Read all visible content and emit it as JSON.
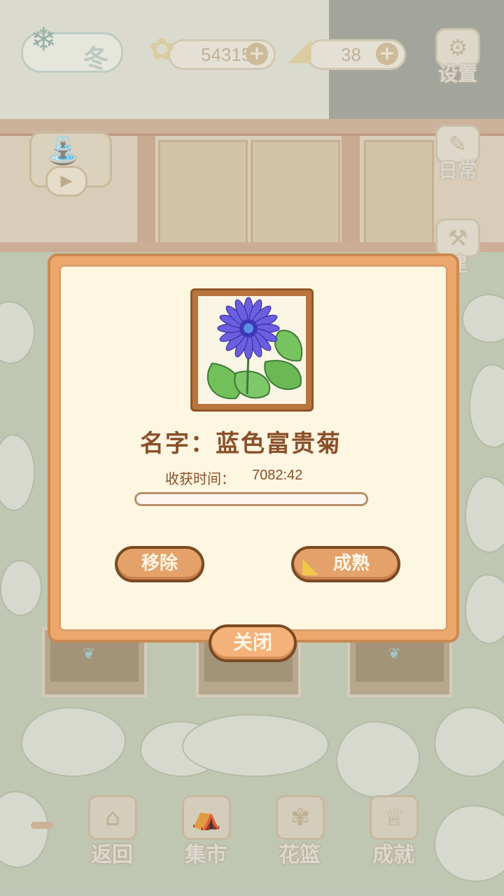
{
  "hud": {
    "season_label": "冬",
    "fish_coins": "54315",
    "cheese": "38",
    "plus_symbol": "+",
    "settings_label": "设置",
    "daily_label": "日常",
    "build_label": "建"
  },
  "dialog": {
    "flower_name": "名字：蓝色富贵菊",
    "harvest_label": "收获时间：",
    "harvest_time": "7082:42",
    "progress_fraction": 0.0,
    "remove_label": "移除",
    "ripen_label": "成熟",
    "close_label": "关闭"
  },
  "bottom_nav": {
    "back_label": "返回",
    "market_label": "集市",
    "basket_label": "花篮",
    "achievements_label": "成就"
  },
  "colors": {
    "dialog_border": "#eea76a",
    "dialog_bg": "#fdf6e1",
    "text_brown": "#8a4f2a",
    "button_fill": "#e4a26a",
    "flower_petal": "#6c5ee0",
    "leaf": "#6fbf57"
  }
}
